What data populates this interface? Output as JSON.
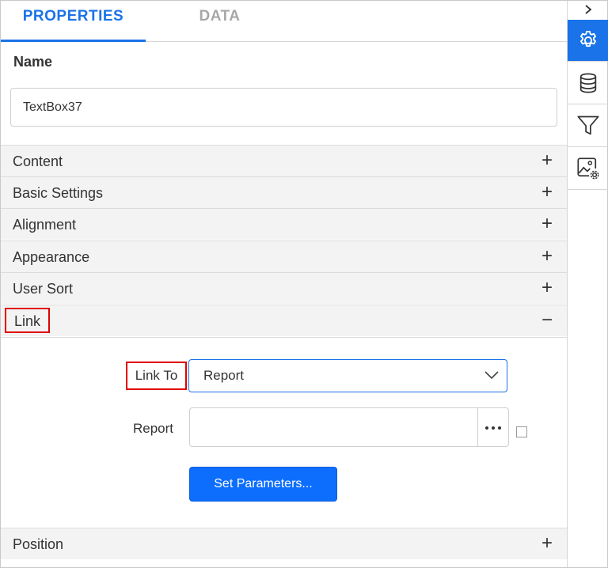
{
  "tabs": [
    {
      "label": "PROPERTIES",
      "active": true
    },
    {
      "label": "DATA",
      "active": false
    }
  ],
  "name": {
    "label": "Name",
    "value": "TextBox37"
  },
  "sections": {
    "content": {
      "label": "Content",
      "sign": "+"
    },
    "basic_settings": {
      "label": "Basic Settings",
      "sign": "+"
    },
    "alignment": {
      "label": "Alignment",
      "sign": "+"
    },
    "appearance": {
      "label": "Appearance",
      "sign": "+"
    },
    "user_sort": {
      "label": "User Sort",
      "sign": "+"
    },
    "link": {
      "label": "Link",
      "sign": "−"
    },
    "position": {
      "label": "Position",
      "sign": "+"
    }
  },
  "link": {
    "link_to_label": "Link To",
    "link_to_value": "Report",
    "report_label": "Report",
    "report_value": "",
    "dots": "•••",
    "set_parameters_label": "Set Parameters..."
  },
  "sidebar": {
    "icons": [
      "chevron-right-icon",
      "gear-icon",
      "database-icon",
      "filter-icon",
      "image-settings-icon"
    ]
  },
  "colors": {
    "accent": "#1a73e8",
    "button": "#0d6efd",
    "highlight": "#e00000",
    "panel_header": "#f3f3f3"
  }
}
